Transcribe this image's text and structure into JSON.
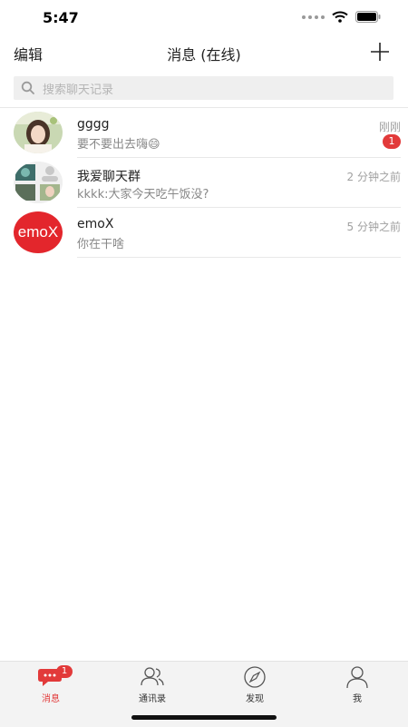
{
  "status_bar": {
    "time": "5:47"
  },
  "nav": {
    "left_label": "编辑",
    "title": "消息 (在线)"
  },
  "search": {
    "placeholder": "搜索聊天记录"
  },
  "conversations": [
    {
      "name": "gggg",
      "preview": "要不要出去嗨😄",
      "time": "刚刚",
      "badge": "1"
    },
    {
      "name": "我爱聊天群",
      "preview": "kkkk:大家今天吃午饭没?",
      "time": "2 分钟之前"
    },
    {
      "name": "emoX",
      "preview": "你在干啥",
      "time": "5 分钟之前",
      "avatar_text": "emoX"
    }
  ],
  "tabs": [
    {
      "label": "消息",
      "badge": "1",
      "active": true
    },
    {
      "label": "通讯录"
    },
    {
      "label": "发现"
    },
    {
      "label": "我"
    }
  ],
  "colors": {
    "accent": "#e23a3a",
    "tab_bg": "#f3f3f3",
    "search_bg": "#efefef"
  }
}
